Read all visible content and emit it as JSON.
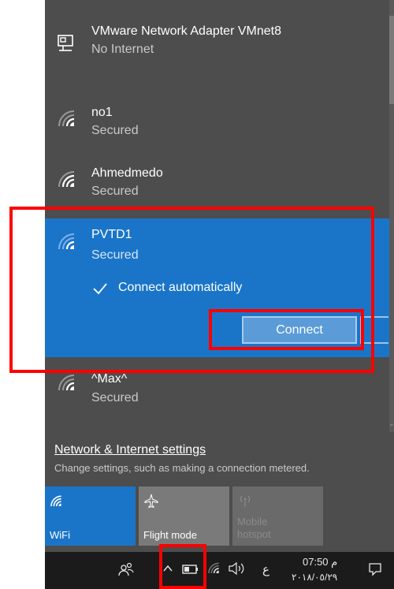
{
  "networks": [
    {
      "name": "VMware Network Adapter VMnet8",
      "status": "No Internet",
      "icon": "ethernet-icon"
    },
    {
      "name": "no1",
      "status": "Secured",
      "icon": "wifi-icon"
    },
    {
      "name": "Ahmedmedo",
      "status": "Secured",
      "icon": "wifi-icon"
    },
    {
      "name": "PVTD1",
      "status": "Secured",
      "icon": "wifi-icon"
    },
    {
      "name": "^Max^",
      "status": "Secured",
      "icon": "wifi-icon"
    }
  ],
  "selected": {
    "connect_automatically_label": "Connect automatically",
    "connect_automatically_checked": true,
    "connect_label": "Connect"
  },
  "settings": {
    "link": "Network & Internet settings",
    "description": "Change settings, such as making a connection metered."
  },
  "quick_actions": [
    {
      "label": "WiFi",
      "icon": "wifi-icon",
      "active": true
    },
    {
      "label": "Flight mode",
      "icon": "airplane-icon",
      "active": false
    },
    {
      "label": "Mobile hotspot",
      "icon": "hotspot-icon",
      "active": false,
      "disabled": true
    }
  ],
  "taskbar": {
    "language": "ع",
    "time": "م 07:50",
    "date": "٢٠١٨/٠٥/٢٩",
    "icons": [
      "people-icon",
      "chevron-up-icon",
      "battery-icon",
      "wifi-icon",
      "volume-icon",
      "language-indicator",
      "action-center-icon"
    ]
  },
  "colors": {
    "accent": "#1a75c9",
    "flyout_bg": "#4d4d4d",
    "taskbar_bg": "#1b1b1b",
    "highlight": "#ff0000"
  }
}
